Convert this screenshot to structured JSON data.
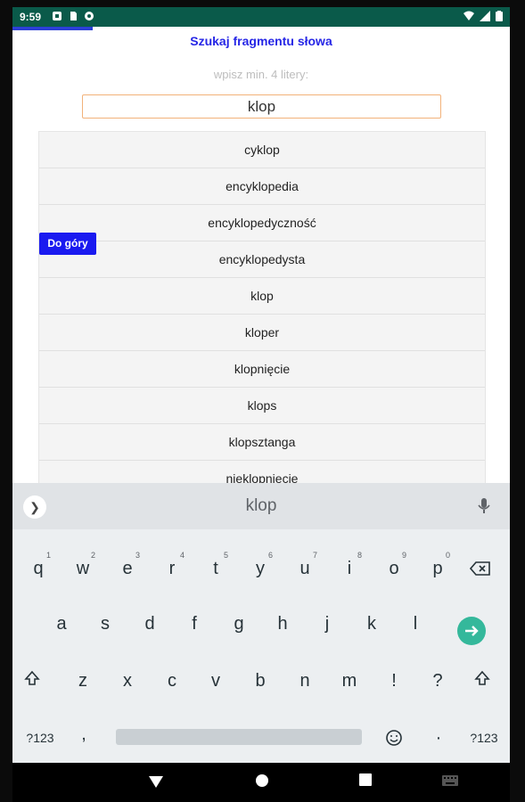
{
  "status_bar": {
    "time": "9:59"
  },
  "page": {
    "title": "Szukaj fragmentu słowa",
    "hint": "wpisz min. 4 litery:",
    "search_value": "klop",
    "scroll_top_label": "Do góry",
    "results": [
      "cyklop",
      "encyklopedia",
      "encyklopedyczność",
      "encyklopedysta",
      "klop",
      "kloper",
      "klopnięcie",
      "klops",
      "klopsztanga",
      "nieklopnięcie"
    ]
  },
  "keyboard": {
    "suggestion": "klop",
    "row1": [
      {
        "k": "q",
        "n": "1"
      },
      {
        "k": "w",
        "n": "2"
      },
      {
        "k": "e",
        "n": "3"
      },
      {
        "k": "r",
        "n": "4"
      },
      {
        "k": "t",
        "n": "5"
      },
      {
        "k": "y",
        "n": "6"
      },
      {
        "k": "u",
        "n": "7"
      },
      {
        "k": "i",
        "n": "8"
      },
      {
        "k": "o",
        "n": "9"
      },
      {
        "k": "p",
        "n": "0"
      }
    ],
    "row2": [
      "a",
      "s",
      "d",
      "f",
      "g",
      "h",
      "j",
      "k",
      "l"
    ],
    "row3": [
      "z",
      "x",
      "c",
      "v",
      "b",
      "n",
      "m",
      "!",
      "?"
    ],
    "symbols_label": "?123",
    "comma": ",",
    "period": "·",
    "symbols_label_right": "?123"
  },
  "icons": {
    "expand": "chevron-right-icon",
    "mic": "microphone-icon",
    "backspace": "backspace-icon",
    "enter": "enter-arrow-icon",
    "shift": "shift-icon",
    "emoji": "emoji-icon",
    "nav_back": "back-triangle-icon",
    "nav_home": "home-circle-icon",
    "nav_recents": "recents-square-icon",
    "nav_keyboard": "keyboard-icon"
  },
  "colors": {
    "status_bar": "#0a5a4a",
    "title": "#2626e6",
    "scroll_top": "#1a1af0",
    "enter": "#34b89b",
    "input_border": "#f2b27a"
  }
}
